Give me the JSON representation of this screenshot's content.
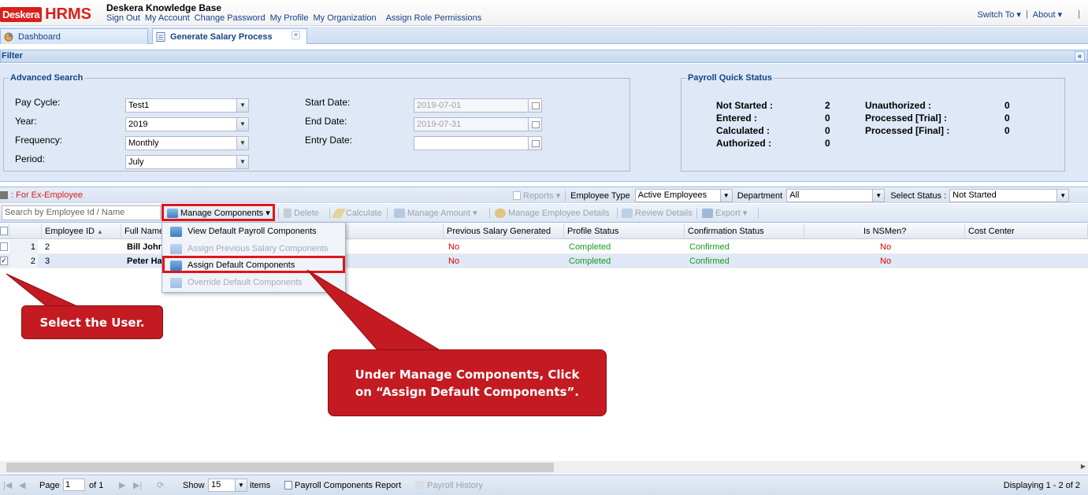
{
  "header": {
    "logo_desk": "Desk",
    "logo_era": "era",
    "logo_hrms": "HRMS",
    "kb_title": "Deskera Knowledge Base",
    "nav": [
      "Sign Out",
      "My Account",
      "Change Password",
      "My Profile",
      "My Organization",
      "Assign Role Permissions"
    ],
    "switch_to": "Switch To",
    "about": "About",
    "caret": "▾",
    "sep": "|"
  },
  "tabs": [
    {
      "label": "Dashboard",
      "active": false
    },
    {
      "label": "Generate Salary Process",
      "active": true
    }
  ],
  "tab_close": "×",
  "filter": {
    "title": "Filter",
    "collapse": "«",
    "advanced_search": {
      "legend": "Advanced Search",
      "pay_cycle_label": "Pay Cycle:",
      "pay_cycle_value": "Test1",
      "year_label": "Year:",
      "year_value": "2019",
      "frequency_label": "Frequency:",
      "frequency_value": "Monthly",
      "period_label": "Period:",
      "period_value": "July",
      "start_date_label": "Start Date:",
      "start_date_value": "2019-07-01",
      "end_date_label": "End Date:",
      "end_date_value": "2019-07-31",
      "entry_date_label": "Entry Date:",
      "entry_date_value": ""
    },
    "quick_status": {
      "legend": "Payroll Quick Status",
      "not_started_label": "Not Started :",
      "not_started_value": "2",
      "entered_label": "Entered :",
      "entered_value": "0",
      "calculated_label": "Calculated :",
      "calculated_value": "0",
      "authorized_label": "Authorized :",
      "authorized_value": "0",
      "unauthorized_label": "Unauthorized :",
      "unauthorized_value": "0",
      "processed_trial_label": "Processed [Trial] :",
      "processed_trial_value": "0",
      "processed_final_label": "Processed [Final] :",
      "processed_final_value": "0"
    }
  },
  "toolbar1": {
    "ex_employee": ": For Ex-Employee",
    "reports": "Reports",
    "employee_type_label": "Employee Type",
    "employee_type_value": "Active Employees",
    "department_label": "Department",
    "department_value": "All",
    "select_status_label": "Select Status :",
    "select_status_value": "Not Started"
  },
  "toolbar2": {
    "search_placeholder": "Search by Employee Id / Name",
    "manage_components": "Manage Components",
    "delete": "Delete",
    "calculate": "Calculate",
    "manage_amount": "Manage Amount",
    "manage_employee_details": "Manage Employee Details",
    "review_details": "Review Details",
    "export": "Export"
  },
  "grid": {
    "columns": [
      "Employee ID",
      "Full Name",
      "Previous Salary Generated",
      "Profile Status",
      "Confirmation Status",
      "Is NSMen?",
      "Cost Center"
    ],
    "sort_indicator": "▲",
    "rows": [
      {
        "num": "1",
        "id": "2",
        "name": "Bill Johns",
        "prev": "No",
        "profile": "Completed",
        "confirmation": "Confirmed",
        "nsmen": "No",
        "cost_center": "",
        "checked": false
      },
      {
        "num": "2",
        "id": "3",
        "name": "Peter Ha",
        "prev": "No",
        "profile": "Completed",
        "confirmation": "Confirmed",
        "nsmen": "No",
        "cost_center": "",
        "checked": true
      }
    ]
  },
  "menu": {
    "items": [
      {
        "label": "View Default Payroll Components",
        "enabled": true
      },
      {
        "label": "Assign Previous Salary Components",
        "enabled": false
      },
      {
        "label": "Assign Default Components",
        "enabled": true
      },
      {
        "label": "Override Default Components",
        "enabled": false
      }
    ]
  },
  "pager": {
    "page_label": "Page",
    "page_value": "1",
    "of_label": "of 1",
    "show_label": "Show",
    "show_value": "15",
    "items_label": "items",
    "payroll_components_report": "Payroll Components Report",
    "payroll_history": "Payroll History",
    "displaying": "Displaying 1 - 2 of 2"
  },
  "callouts": {
    "select_user": "Select the User.",
    "instruction_line1": "Under Manage Components, Click",
    "instruction_line2": "on “Assign Default Components”."
  },
  "colors": {
    "brand_red": "#d8201b",
    "highlight_red": "#e0151b",
    "callout_red": "#c41a22",
    "link_blue": "#15428b",
    "status_green": "#179c1c",
    "panel_blue": "#dfe8f6"
  }
}
